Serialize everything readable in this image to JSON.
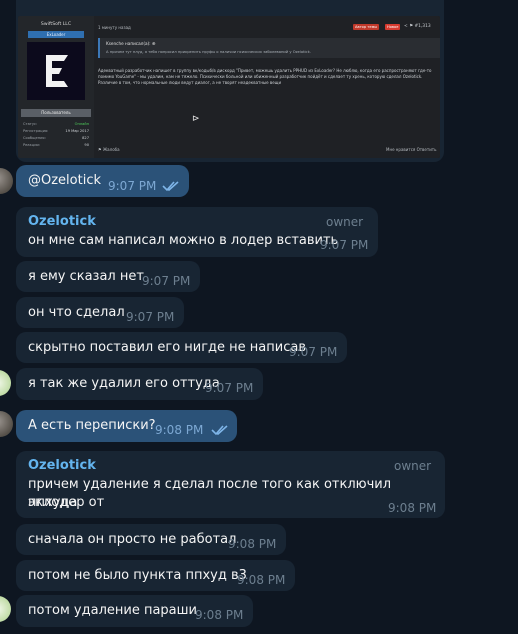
{
  "forum_shot": {
    "username": "SwiftSoft LLC",
    "user_title": "ExLoader",
    "role_label": "Пользователь",
    "stats": [
      {
        "label": "Статус:",
        "value": "Онлайн"
      },
      {
        "label": "Регистрация:",
        "value": "19 Мар 2017"
      },
      {
        "label": "Сообщения:",
        "value": "827"
      },
      {
        "label": "Реакции:",
        "value": "90"
      }
    ],
    "time": "1 минуту назад",
    "tag_author": "Автор темы",
    "tag_new": "Новое",
    "post_number": "#1,313",
    "quote_author": "Ksenche написал(а): ⊕",
    "quote_text": "А причем тут плуд, я тебя попросил прикрепить пруфы о наличии психических заболеваний у Ozelotick.",
    "body_text": "Адекватный разработчик напишет в группу вк/кодыб/в дискорд \"Привет, можешь удалить PPHUD из ExLoader? Не люблю, когда его распространяют где-то помимо YouGame\" - мы удалим, нам не тяжело. Психически больной или обиженный разработчик пойдёт и сделает ту хрень, которую сделал Ozelotick. Различие в том, что нормальные люди ведут диалог, а не творят неадекватные вещи",
    "report_label": "Жалоба",
    "actions_label": "Мне нравится   Ответить"
  },
  "messages": {
    "m1": {
      "text": "@Ozelotick",
      "time": "9:07 PM"
    },
    "m2": {
      "sender": "Ozelotick",
      "role": "owner",
      "text": "он мне сам написал можно в лодер вставить",
      "time": "9:07 PM"
    },
    "m3": {
      "text": "я ему сказал нет",
      "time": "9:07 PM"
    },
    "m4": {
      "text": "он что сделал",
      "time": "9:07 PM"
    },
    "m5": {
      "text": "скрытно поставил его нигде не написав",
      "time": "9:07 PM"
    },
    "m6": {
      "text": "я так же удалил его оттуда",
      "time": "9:07 PM"
    },
    "m7": {
      "text": "А есть переписки?",
      "time": "9:08 PM"
    },
    "m8": {
      "sender": "Ozelotick",
      "role": "owner",
      "text_line1": "причем удаление я сделал после того как отключил эклодер от",
      "text_line2": "ппхуда",
      "time": "9:08 PM"
    },
    "m9": {
      "text": "сначала он просто не работал",
      "time": "9:08 PM"
    },
    "m10": {
      "text": "потом не было пункта ппхуд в3",
      "time": "9:08 PM"
    },
    "m11": {
      "text": "потом удаление параши",
      "time": "9:08 PM"
    }
  },
  "icons": {
    "read_receipt": "double-check-icon",
    "outgoing_bubble_color": "#2b5278",
    "incoming_bubble_color": "#182533",
    "sender_name_color": "#64b5ef"
  }
}
